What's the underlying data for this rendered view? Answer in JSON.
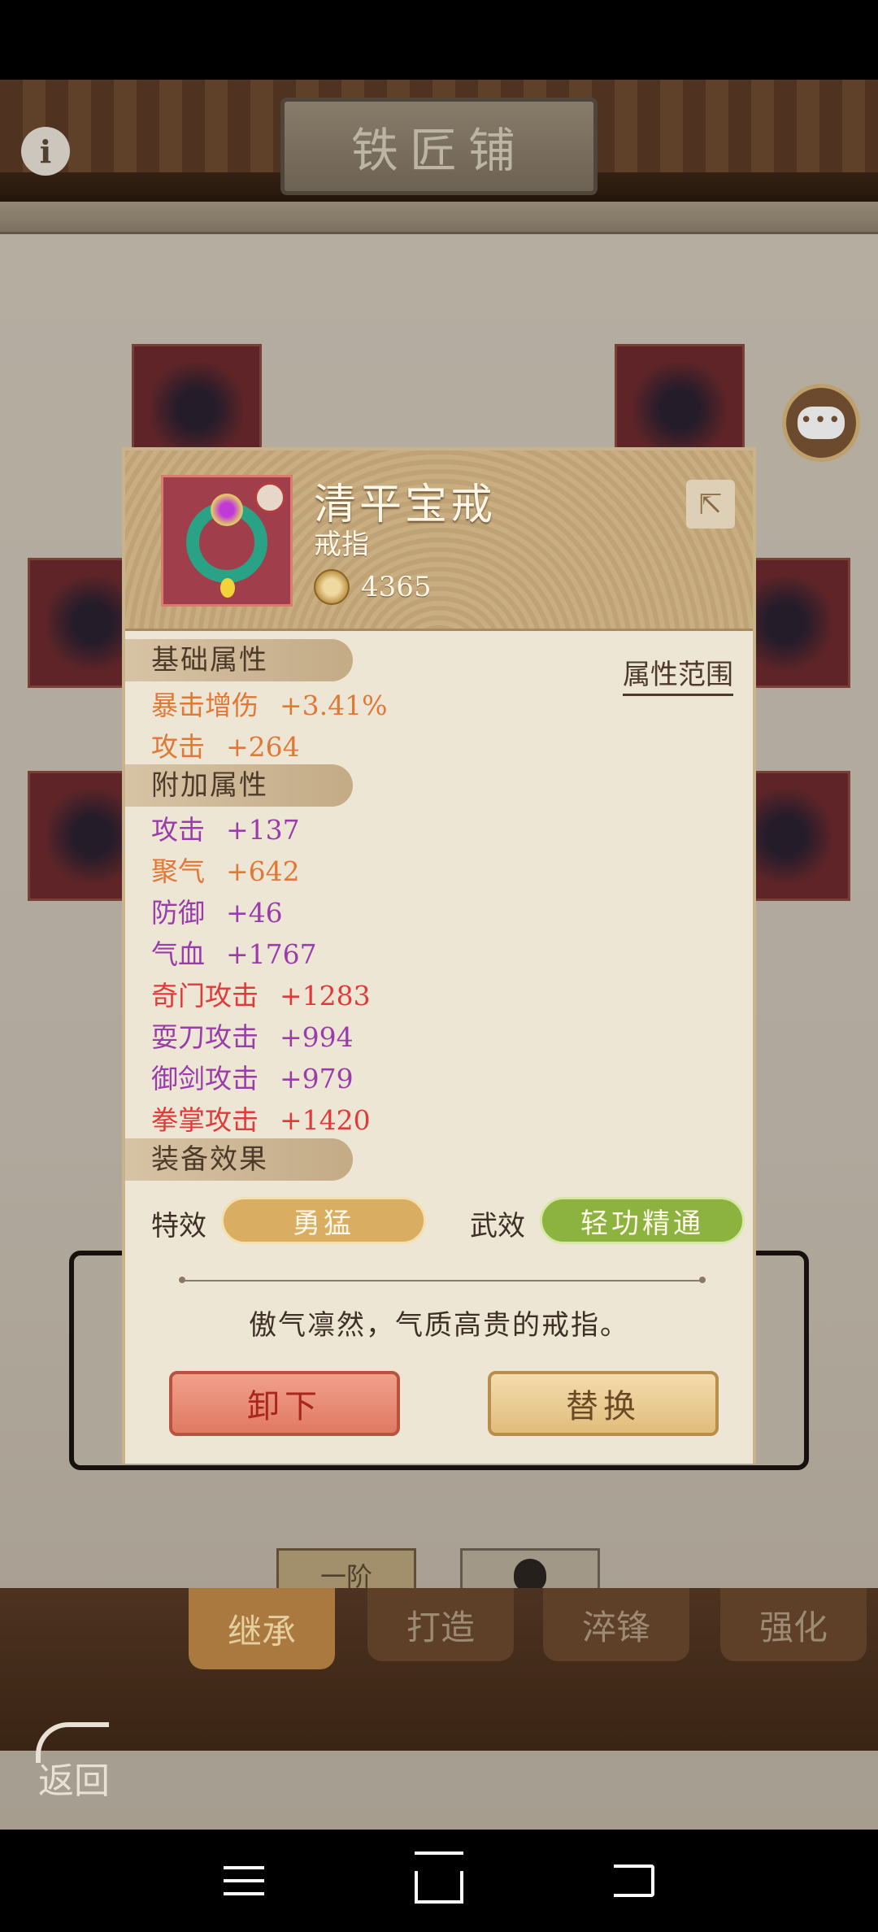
{
  "screen": {
    "title": "铁匠铺",
    "info_icon": "info-icon",
    "chat_icon": "chat-bubble-icon"
  },
  "item": {
    "name": "清平宝戒",
    "type": "戒指",
    "power": "4365",
    "icon": "jade-ring-icon"
  },
  "sections": {
    "base_attr": "基础属性",
    "extra_attr": "附加属性",
    "effects": "装备效果",
    "range_link": "属性范围"
  },
  "base_stats": [
    {
      "name": "暴击增伤",
      "value": "+3.41%",
      "color": "#e07838"
    },
    {
      "name": "攻击",
      "value": "+264",
      "color": "#e07838"
    }
  ],
  "extra_stats": [
    {
      "name": "攻击",
      "value": "+137",
      "color": "#9a3cab"
    },
    {
      "name": "聚气",
      "value": "+642",
      "color": "#e07838"
    },
    {
      "name": "防御",
      "value": "+46",
      "color": "#9a3cab"
    },
    {
      "name": "气血",
      "value": "+1767",
      "color": "#9a3cab"
    },
    {
      "name": "奇门攻击",
      "value": "+1283",
      "color": "#e03a3a"
    },
    {
      "name": "耍刀攻击",
      "value": "+994",
      "color": "#9a3cab"
    },
    {
      "name": "御剑攻击",
      "value": "+979",
      "color": "#9a3cab"
    },
    {
      "name": "拳掌攻击",
      "value": "+1420",
      "color": "#e03a3a"
    }
  ],
  "effects": {
    "special_label": "特效",
    "special_value": "勇猛",
    "martial_label": "武效",
    "martial_value": "轻功精通"
  },
  "flavor_text": "傲气凛然，气质高贵的戒指。",
  "buttons": {
    "unequip": "卸下",
    "replace": "替换"
  },
  "lower": {
    "tier_label": "一阶",
    "lock_icon": "lock-icon"
  },
  "tabs": [
    {
      "label": "继承",
      "active": true
    },
    {
      "label": "打造",
      "active": false
    },
    {
      "label": "淬锋",
      "active": false
    },
    {
      "label": "强化",
      "active": false
    }
  ],
  "back_label": "返回"
}
